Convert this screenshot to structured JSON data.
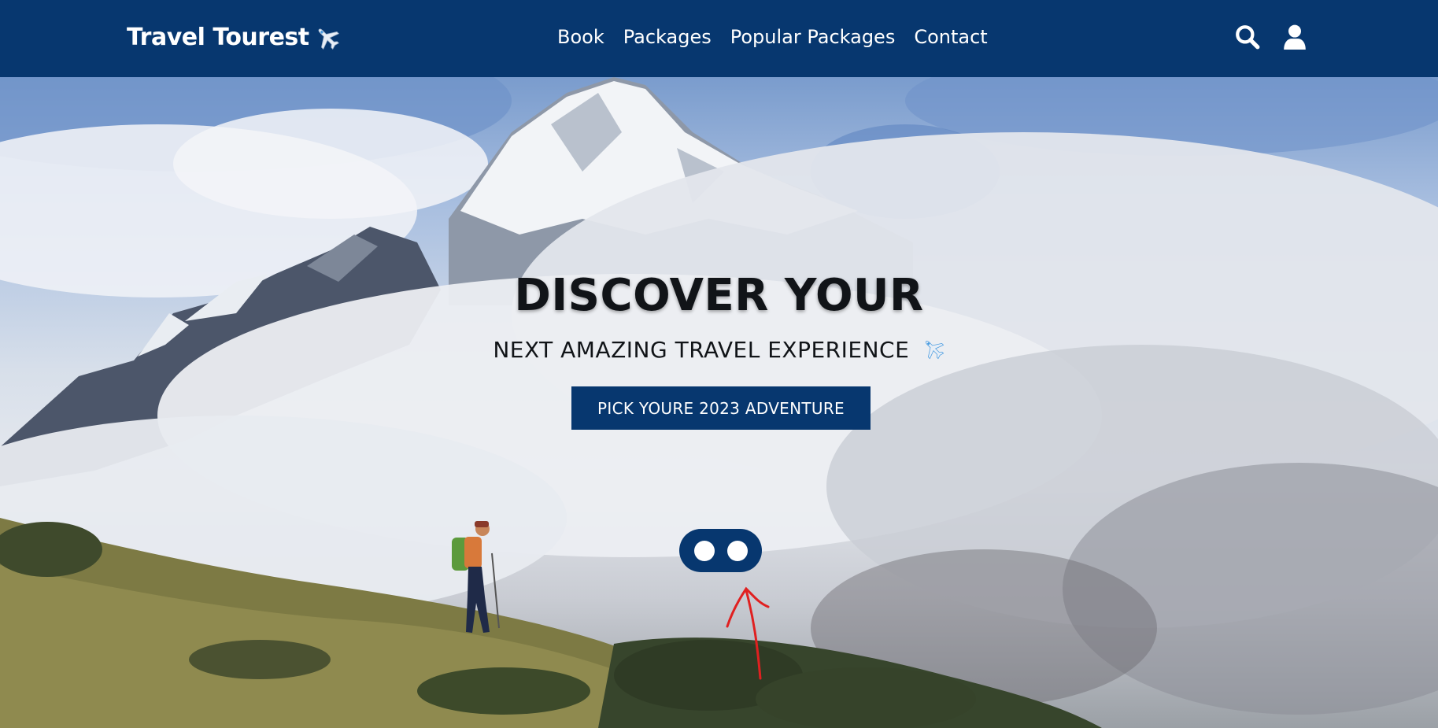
{
  "brand": {
    "name": "Travel Tourest",
    "icon": "airplane-icon"
  },
  "nav": {
    "links": [
      {
        "label": "Book"
      },
      {
        "label": "Packages"
      },
      {
        "label": "Popular Packages"
      },
      {
        "label": "Contact"
      }
    ],
    "icons": [
      "search-icon",
      "user-icon"
    ]
  },
  "hero": {
    "title": "DISCOVER YOUR",
    "subtitle": "NEXT AMAZING TRAVEL EXPERIENCE",
    "cta_label": "PICK YOURE 2023 ADVENTURE",
    "slider_dots": 2
  },
  "colors": {
    "navbar": "#07376f",
    "button": "#07376f",
    "text_dark": "#111418",
    "annotation_arrow": "#e02020"
  }
}
